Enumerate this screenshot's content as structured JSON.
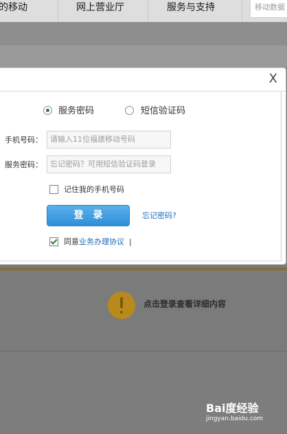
{
  "nav": {
    "items": [
      "我的移动",
      "网上营业厅",
      "服务与支持"
    ],
    "search_placeholder": "移动数据"
  },
  "background": {
    "info_text": "点击登录查看详细内容"
  },
  "dialog": {
    "close": "X",
    "tabs": [
      {
        "label": "服务密码",
        "selected": true
      },
      {
        "label": "短信验证码",
        "selected": false
      }
    ],
    "phone": {
      "label": "手机号码：",
      "placeholder": "请输入11位福建移动号码"
    },
    "password": {
      "label": "服务密码：",
      "placeholder": "忘记密码？可用短信验证码登录"
    },
    "remember": {
      "label": "记住我的手机号码",
      "checked": false
    },
    "login_button": "登录",
    "forgot_link": "忘记密码?",
    "agree": {
      "prefix": "同意",
      "link": "业务办理协议",
      "suffix": "|",
      "checked": true
    }
  },
  "watermark": {
    "text": "Bai度经验",
    "sub": "jingyan.baidu.com"
  },
  "colors": {
    "accent_blue": "#2f8fd8",
    "link_blue": "#1e6bb8",
    "overlay_gray": "#7f7f7f",
    "check_green": "#2f7d2f"
  }
}
